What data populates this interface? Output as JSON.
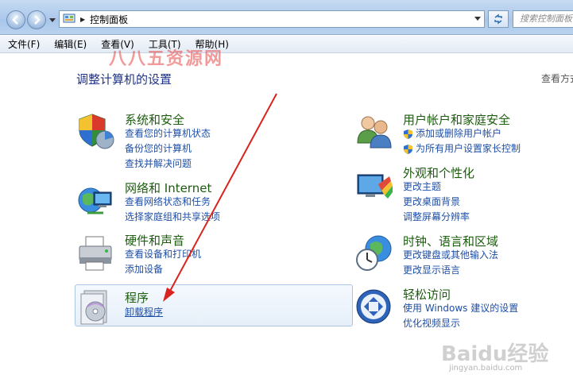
{
  "address": {
    "location": "控制面板",
    "search_placeholder": "搜索控制面板"
  },
  "menu": [
    "文件(F)",
    "编辑(E)",
    "查看(V)",
    "工具(T)",
    "帮助(H)"
  ],
  "watermark": "八八五资源网",
  "page_title": "调整计算机的设置",
  "view_by": "查看方式",
  "categories": {
    "system": {
      "title": "系统和安全",
      "links": [
        "查看您的计算机状态",
        "备份您的计算机",
        "查找并解决问题"
      ]
    },
    "network": {
      "title": "网络和 Internet",
      "links": [
        "查看网络状态和任务",
        "选择家庭组和共享选项"
      ]
    },
    "hardware": {
      "title": "硬件和声音",
      "links": [
        "查看设备和打印机",
        "添加设备"
      ]
    },
    "programs": {
      "title": "程序",
      "links": [
        "卸载程序"
      ]
    },
    "users": {
      "title": "用户帐户和家庭安全",
      "links": [
        "添加或删除用户帐户",
        "为所有用户设置家长控制"
      ]
    },
    "appearance": {
      "title": "外观和个性化",
      "links": [
        "更改主题",
        "更改桌面背景",
        "调整屏幕分辨率"
      ]
    },
    "clock": {
      "title": "时钟、语言和区域",
      "links": [
        "更改键盘或其他输入法",
        "更改显示语言"
      ]
    },
    "ease": {
      "title": "轻松访问",
      "links": [
        "使用 Windows 建议的设置",
        "优化视频显示"
      ]
    }
  },
  "footer_watermark": {
    "logo": "Baidu经验",
    "url": "jingyan.baidu.com"
  },
  "colors": {
    "title_green": "#1c5c0e",
    "link_blue": "#1e4fa6",
    "arrow_red": "#d9231e"
  }
}
